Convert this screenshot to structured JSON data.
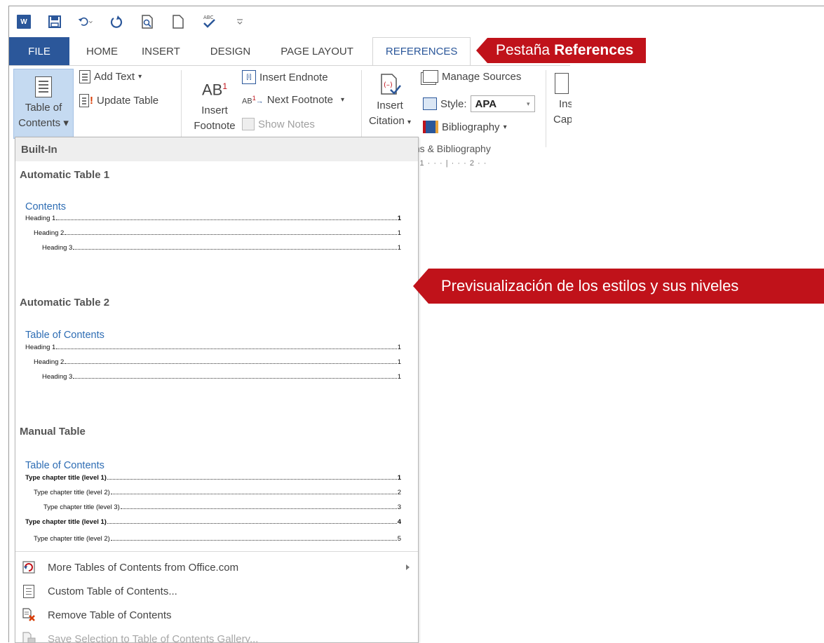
{
  "tabs": {
    "file": "FILE",
    "home": "HOME",
    "insert": "INSERT",
    "design": "DESIGN",
    "page_layout": "PAGE LAYOUT",
    "references": "REFERENCES"
  },
  "callouts": {
    "tab_prefix": "Pestaña",
    "tab_bold": "References",
    "preview": "Previsualización de los estilos y sus niveles"
  },
  "ribbon": {
    "toc_line1": "Table of",
    "toc_line2": "Contents",
    "add_text": "Add Text",
    "update_table": "Update Table",
    "insert_footnote_line1": "Insert",
    "insert_footnote_line2": "Footnote",
    "ab_glyph": "AB",
    "ab_super": "1",
    "insert_endnote": "Insert Endnote",
    "next_footnote": "Next Footnote",
    "show_notes": "Show Notes",
    "insert_citation_line1": "Insert",
    "insert_citation_line2": "Citation",
    "manage_sources": "Manage Sources",
    "style_label": "Style:",
    "style_value": "APA",
    "bibliography": "Bibliography",
    "group_citations": "ions & Bibliography",
    "captions_line1": "Ins",
    "captions_line2": "Cap",
    "ruler": "· · 1 · · · | · · · 2 · ·"
  },
  "gallery": {
    "builtin": "Built-In",
    "auto1_title": "Automatic Table 1",
    "auto1_head": "Contents",
    "auto2_title": "Automatic Table 2",
    "auto2_head": "Table of Contents",
    "manual_title": "Manual Table",
    "manual_head": "Table of Contents",
    "heading1": "Heading 1",
    "heading2": "Heading 2",
    "heading3": "Heading 3",
    "page1": "1",
    "m_l1": "Type chapter title (level 1)",
    "m_l2": "Type chapter title (level 2)",
    "m_l3": "Type chapter title (level 3)",
    "p2": "2",
    "p3": "3",
    "p4": "4",
    "p5": "5"
  },
  "menu": {
    "more": "More Tables of Contents from Office.com",
    "custom": "Custom Table of Contents...",
    "remove": "Remove Table of Contents",
    "save": "Save Selection to Table of Contents Gallery..."
  },
  "colors": {
    "accent": "#2b579a",
    "callout": "#c0121a",
    "toc_heading": "#2e6db4"
  }
}
